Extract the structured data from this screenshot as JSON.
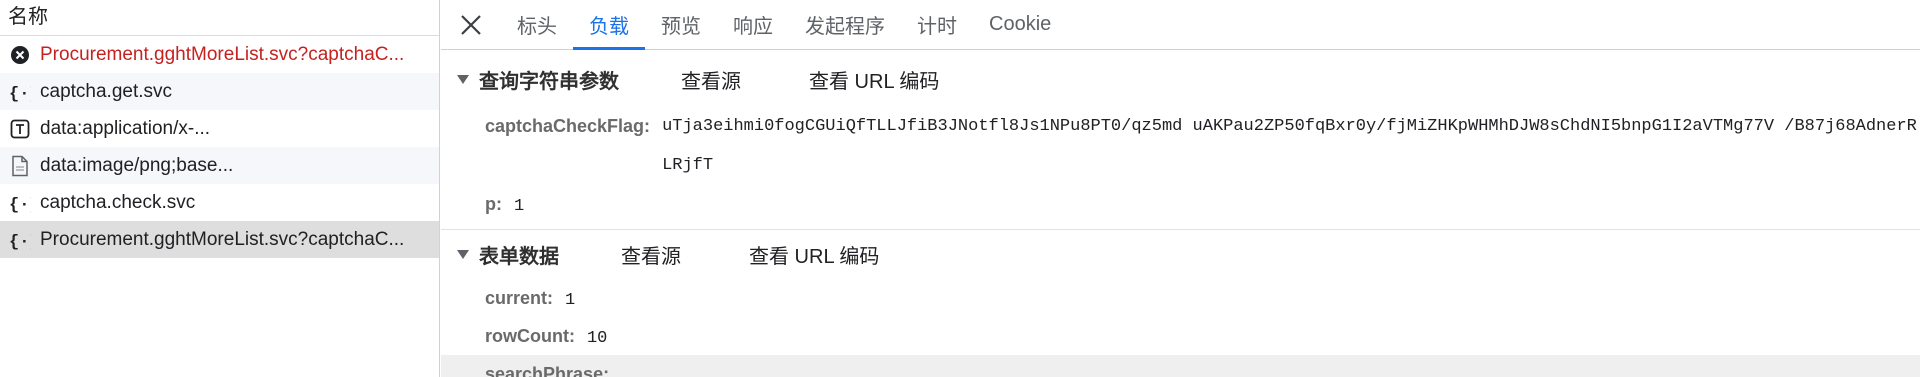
{
  "request_list": {
    "header": "名称",
    "items": [
      {
        "label": "Procurement.gghtMoreList.svc?captchaC...",
        "icon": "error-circle-icon"
      },
      {
        "label": "captcha.get.svc",
        "icon": "json-braces-icon"
      },
      {
        "label": "data:application/x-...",
        "icon": "text-document-icon"
      },
      {
        "label": "data:image/png;base...",
        "icon": "file-icon"
      },
      {
        "label": "captcha.check.svc",
        "icon": "json-braces-icon"
      },
      {
        "label": "Procurement.gghtMoreList.svc?captchaC...",
        "icon": "json-braces-icon"
      }
    ]
  },
  "tabs": {
    "close_icon": "close-icon",
    "items": [
      "标头",
      "负载",
      "预览",
      "响应",
      "发起程序",
      "计时",
      "Cookie"
    ],
    "active": "负载"
  },
  "query_section": {
    "title": "查询字符串参数",
    "view_source": "查看源",
    "view_url_encoded": "查看 URL 编码",
    "params": [
      {
        "key": "captchaCheckFlag:",
        "value": "uTja3eihmi0fogCGUiQfTLLJfiB3JNotfl8Js1NPu8PT0/qz5md uAKPau2ZP50fqBxr0y/fjMiZHKpWHMhDJW8sChdNI5bnpG1I2aVTMg77V /B87j68AdnerRLRjfT"
      },
      {
        "key": "p:",
        "value": "1"
      }
    ]
  },
  "form_section": {
    "title": "表单数据",
    "view_source": "查看源",
    "view_url_encoded": "查看 URL 编码",
    "params": [
      {
        "key": "current:",
        "value": "1"
      },
      {
        "key": "rowCount:",
        "value": "10"
      },
      {
        "key": "searchPhrase:",
        "value": ""
      }
    ]
  },
  "colors": {
    "accent": "#1a73e8",
    "error": "#c5221f",
    "selected_row": "#dedede"
  }
}
